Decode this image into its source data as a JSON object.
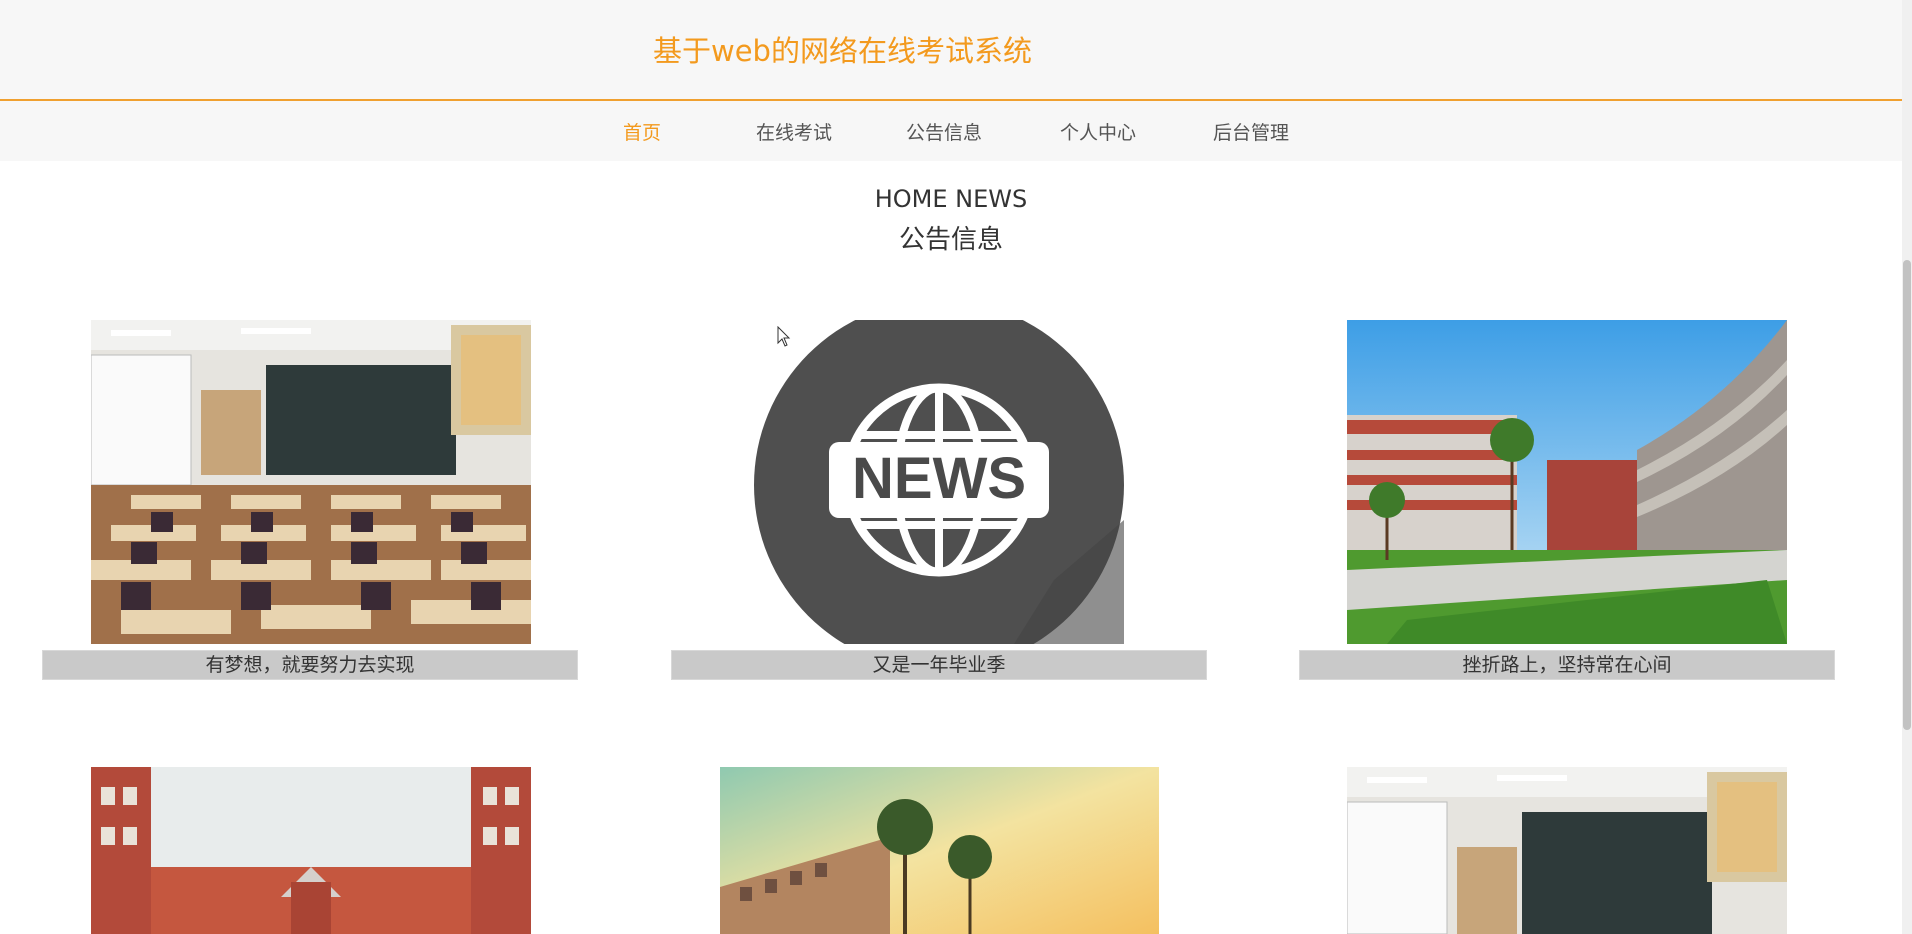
{
  "header": {
    "title": "基于web的网络在线考试系统"
  },
  "nav": {
    "items": [
      {
        "label": "首页",
        "active": true
      },
      {
        "label": "在线考试",
        "active": false
      },
      {
        "label": "公告信息",
        "active": false
      },
      {
        "label": "个人中心",
        "active": false
      },
      {
        "label": "后台管理",
        "active": false
      }
    ]
  },
  "section": {
    "title_en": "HOME NEWS",
    "title_cn": "公告信息"
  },
  "news": [
    {
      "caption": "有梦想，就要努力去实现",
      "image": "classroom-photo"
    },
    {
      "caption": "又是一年毕业季",
      "image": "news-globe-icon"
    },
    {
      "caption": "挫折路上，坚持常在心间",
      "image": "campus-courtyard-photo"
    },
    {
      "caption": "",
      "image": "school-building-photo"
    },
    {
      "caption": "",
      "image": "sunset-building-photo"
    },
    {
      "caption": "",
      "image": "classroom-photo"
    }
  ],
  "colors": {
    "accent": "#f39a1e",
    "nav_bg": "#f7f7f7",
    "caption_bg": "#c9c9c9",
    "text": "#333333"
  }
}
